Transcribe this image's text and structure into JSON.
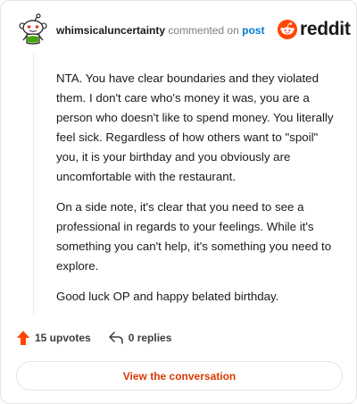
{
  "header": {
    "username": "whimsicaluncertainty",
    "action_text": "commented on",
    "post_link": "post",
    "brand_name": "reddit",
    "brand_color": "#ff4500"
  },
  "comment": {
    "paragraphs": [
      "NTA. You have clear boundaries and they violated them. I don't care who's money it was, you are a person who doesn't like to spend money. You literally feel sick. Regardless of how others want to \"spoil\" you, it is your birthday and you obviously are uncomfortable with the restaurant.",
      "On a side note, it's clear that you need to see a professional in regards to your feelings. While it's something you can't help, it's something you need to explore.",
      "Good luck OP and happy belated birthday."
    ]
  },
  "stats": {
    "upvotes_label": "15 upvotes",
    "replies_label": "0 replies",
    "upvote_icon": "upvote-arrow-icon",
    "reply_icon": "reply-arrow-icon",
    "upvote_color": "#ff4500"
  },
  "footer": {
    "view_button_label": "View the conversation",
    "button_text_color": "#d93a00"
  }
}
